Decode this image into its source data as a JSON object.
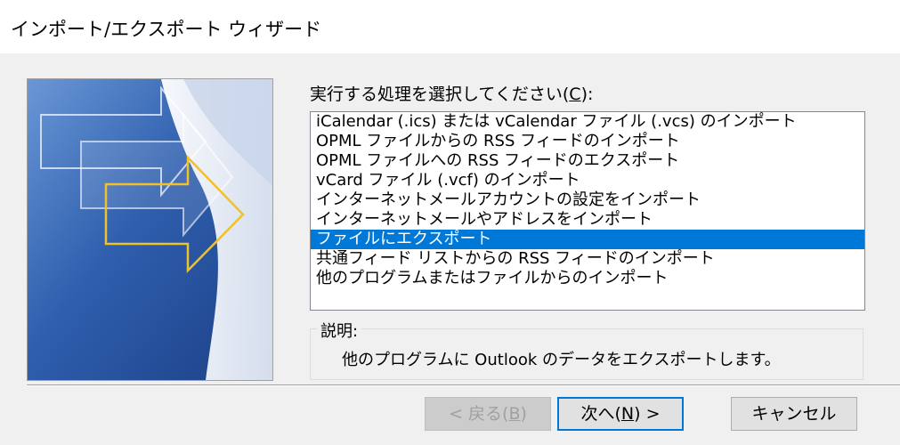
{
  "window": {
    "title": "インポート/エクスポート ウィザード"
  },
  "prompt": {
    "text": "実行する処理を選択してください(",
    "mnemonic": "C",
    "suffix": "):"
  },
  "actions": [
    "iCalendar (.ics) または vCalendar ファイル (.vcs) のインポート",
    "OPML ファイルからの RSS フィードのインポート",
    "OPML ファイルへの RSS フィードのエクスポート",
    "vCard ファイル (.vcf) のインポート",
    "インターネットメールアカウントの設定をインポート",
    "インターネットメールやアドレスをインポート",
    "ファイルにエクスポート",
    "共通フィード リストからの RSS フィードのインポート",
    "他のプログラムまたはファイルからのインポート"
  ],
  "selected_action": "ファイルにエクスポート",
  "description": {
    "label": "説明:",
    "text": "他のプログラムに Outlook のデータをエクスポートします。"
  },
  "buttons": {
    "back": {
      "text": "< 戻る(",
      "mnemonic": "B",
      "suffix": ")"
    },
    "next": {
      "text": "次へ(",
      "mnemonic": "N",
      "suffix": ") >"
    },
    "cancel": {
      "label": "キャンセル"
    }
  },
  "colors": {
    "selection": "#0078d7",
    "arrow_outline": "#f2c029",
    "panel_blue": "#4a78c0"
  }
}
